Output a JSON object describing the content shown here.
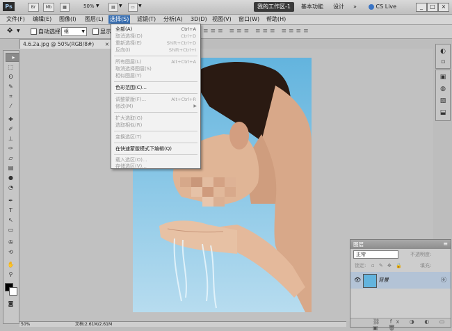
{
  "appbar": {
    "logo": "Ps",
    "br_label": "Br",
    "mb_label": "Mb",
    "zoom": "50%",
    "workspace_active": "我的工作区-1",
    "workspace_essentials": "基本功能",
    "workspace_design": "设计",
    "more_label": "»",
    "cs_live": "CS Live",
    "minimize": "_",
    "restore": "□",
    "close": "×"
  },
  "menubar": {
    "items": [
      "文件(F)",
      "编辑(E)",
      "图像(I)",
      "图层(L)",
      "选择(S)",
      "滤镜(T)",
      "分析(A)",
      "3D(D)",
      "视图(V)",
      "窗口(W)",
      "帮助(H)"
    ]
  },
  "options": {
    "auto_select_label": "自动选择:",
    "auto_select_value": "组",
    "show_transform_label": "显示"
  },
  "document": {
    "tab_title": "4.6.2a.jpg @ 50%(RGB/8#)",
    "tab_close": "×",
    "status_zoom": "50%",
    "status_doc": "文档:2.61M/2.61M"
  },
  "select_menu": {
    "items": [
      {
        "label": "全部(A)",
        "shortcut": "Ctrl+A",
        "disabled": false
      },
      {
        "label": "取消选择(D)",
        "shortcut": "Ctrl+D",
        "disabled": true
      },
      {
        "label": "重新选择(E)",
        "shortcut": "Shift+Ctrl+D",
        "disabled": true
      },
      {
        "label": "反向(I)",
        "shortcut": "Shift+Ctrl+I",
        "disabled": true
      },
      {
        "label": "所有图层(L)",
        "shortcut": "Alt+Ctrl+A",
        "disabled": true
      },
      {
        "label": "取消选择图层(S)",
        "shortcut": "",
        "disabled": true
      },
      {
        "label": "相似图层(Y)",
        "shortcut": "",
        "disabled": true
      },
      {
        "label": "色彩范围(C)...",
        "shortcut": "",
        "disabled": false
      },
      {
        "label": "调整蒙版(F)...",
        "shortcut": "Alt+Ctrl+R",
        "disabled": true
      },
      {
        "label": "修改(M)",
        "shortcut": "",
        "disabled": true,
        "submenu": true
      },
      {
        "label": "扩大选取(G)",
        "shortcut": "",
        "disabled": true
      },
      {
        "label": "选取相似(R)",
        "shortcut": "",
        "disabled": true
      },
      {
        "label": "变换选区(T)",
        "shortcut": "",
        "disabled": true
      },
      {
        "label": "在快速蒙版模式下编辑(Q)",
        "shortcut": "",
        "disabled": false
      },
      {
        "label": "载入选区(O)...",
        "shortcut": "",
        "disabled": true
      },
      {
        "label": "存储选区(V)...",
        "shortcut": "",
        "disabled": true
      }
    ]
  },
  "layers_panel": {
    "tab": "图层",
    "blend_mode": "正常",
    "opacity_label": "不透明度:",
    "lock_label": "锁定:",
    "fill_label": "填充:",
    "layer_name": "背景",
    "link_icon_text": "ⓞ"
  },
  "colors": {
    "menu_highlight": "#3a6fb0",
    "app_bg": "#bdbdbd",
    "panel_bg": "#cdcdcd"
  }
}
